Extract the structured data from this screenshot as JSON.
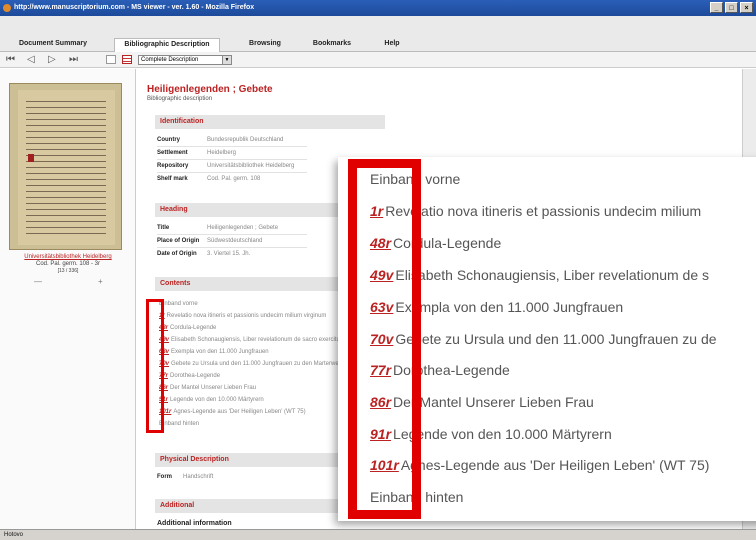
{
  "window": {
    "title": "http://www.manuscriptorium.com - MS viewer - ver. 1.60 - Mozilla Firefox"
  },
  "status": {
    "text": "Hotovo"
  },
  "tabs": [
    {
      "label": "Document Summary"
    },
    {
      "label": "Bibliographic Description",
      "active": true
    },
    {
      "label": "Browsing"
    },
    {
      "label": "Bookmarks"
    },
    {
      "label": "Help"
    }
  ],
  "toolbar": {
    "first_icon": "first-page-icon",
    "prev_icon": "previous-page-icon",
    "next_icon": "next-page-icon",
    "last_icon": "last-page-icon",
    "description_select": "Complete Description"
  },
  "thumbnail": {
    "library": "Universitätsbibliothek Heidelberg",
    "shelfmark": "Cod. Pal. germ. 108 - 3r",
    "page": "[13 / 336]",
    "zoom_out": "—",
    "zoom_in": "+"
  },
  "record": {
    "title": "Heiligenlegenden ; Gebete",
    "subtitle": "Bibliographic description",
    "identification": {
      "heading": "Identification",
      "rows": [
        {
          "label": "Country",
          "value": "Bundesrepublik Deutschland"
        },
        {
          "label": "Settlement",
          "value": "Heidelberg"
        },
        {
          "label": "Repository",
          "value": "Universitätsbibliothek Heidelberg"
        },
        {
          "label": "Shelf mark",
          "value": "Cod. Pal. germ. 108"
        }
      ]
    },
    "heading_section": {
      "heading": "Heading",
      "rows": [
        {
          "label": "Title",
          "value": "Heiligenlegenden ; Gebete"
        },
        {
          "label": "Place of Origin",
          "value": "Südwestdeutschland"
        },
        {
          "label": "Date of Origin",
          "value": "3. Viertel 15. Jh."
        }
      ]
    },
    "contents": {
      "heading": "Contents",
      "rows": [
        {
          "folio": "",
          "text": "Einband vorne"
        },
        {
          "folio": "1r",
          "text": "Revelatio nova itineris et passionis undecim milium virginum"
        },
        {
          "folio": "48r",
          "text": "Cordula-Legende"
        },
        {
          "folio": "49v",
          "text": "Elisabeth Schonaugiensis, Liber revelationum de sacro exercitu virginum Coloniensium"
        },
        {
          "folio": "63v",
          "text": "Exempla von den 11.000 Jungfrauen"
        },
        {
          "folio": "70v",
          "text": "Gebete zu Ursula und den 11.000 Jungfrauen zu den Marterwerkzeugen"
        },
        {
          "folio": "77r",
          "text": "Dorothea-Legende"
        },
        {
          "folio": "86r",
          "text": "Der Mantel Unserer Lieben Frau"
        },
        {
          "folio": "91r",
          "text": "Legende von den 10.000 Märtyrern"
        },
        {
          "folio": "101r",
          "text": "Agnes-Legende aus 'Der Heiligen Leben' (WT 75)"
        },
        {
          "folio": "",
          "text": "Einband hinten"
        }
      ]
    },
    "physical": {
      "heading": "Physical Description",
      "rows": [
        {
          "label": "Form",
          "value": "Handschrift"
        }
      ]
    },
    "additional": {
      "heading": "Additional",
      "subheading": "Additional information"
    }
  },
  "overlay": {
    "rows": [
      {
        "folio": "",
        "text": "Einband vorne"
      },
      {
        "folio": "1r",
        "text": "Revelatio nova itineris et passionis undecim milium"
      },
      {
        "folio": "48r",
        "text": "Cordula-Legende"
      },
      {
        "folio": "49v",
        "text": "Elisabeth Schonaugiensis, Liber revelationum de s"
      },
      {
        "folio": "63v",
        "text": "Exempla von den 11.000 Jungfrauen"
      },
      {
        "folio": "70v",
        "text": "Gebete zu Ursula und den 11.000 Jungfrauen zu de"
      },
      {
        "folio": "77r",
        "text": "Dorothea-Legende"
      },
      {
        "folio": "86r",
        "text": "Der Mantel Unserer Lieben Frau"
      },
      {
        "folio": "91r",
        "text": "Legende von den 10.000 Märtyrern"
      },
      {
        "folio": "101r",
        "text": "Agnes-Legende aus 'Der Heiligen Leben' (WT 75)"
      },
      {
        "folio": "",
        "text": "Einband hinten"
      }
    ]
  },
  "colors": {
    "accent": "#b22222",
    "highlight_box": "#e00000",
    "title_bar": "#1d4a9a"
  }
}
